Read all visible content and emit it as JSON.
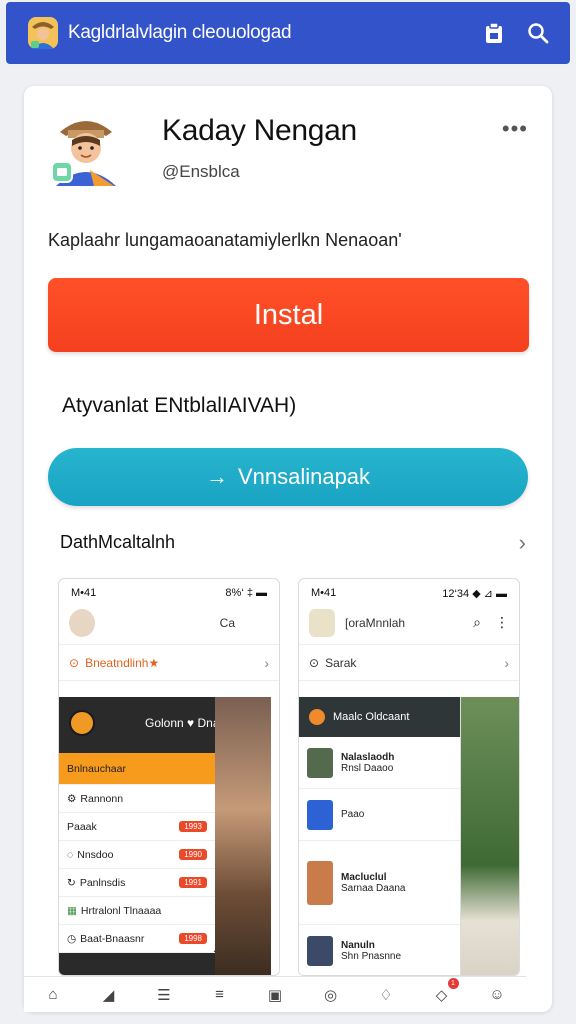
{
  "topbar": {
    "title": "Kagldrlalvlagin cleouologad",
    "icons": [
      "app-logo-icon",
      "clipboard-icon",
      "search-icon"
    ]
  },
  "profile": {
    "name": "Kaday Nengan",
    "handle": "@Ensblca",
    "more_label": "•••"
  },
  "description": "Kaplaahr lungamaoanatamiylerlkn Nenaoan'",
  "install_button": "Instal",
  "advance_text": "Atyvanlat ENtblalIAIVAH)",
  "secondary_button": "Vnnsalinapak",
  "section": {
    "title": "DathMcaltalnh",
    "chevron": "›"
  },
  "screenshots": [
    {
      "status_left": "M•41",
      "status_right": "8%‘ ‡ ▬",
      "head_text": "Ca",
      "row_text": "Bneatndlinh★",
      "panel_title": "Golonn ♥ Dnaenn",
      "menu": [
        {
          "label": "Bnlnauchaar",
          "pill": ""
        },
        {
          "label": "Rannonn",
          "pill": ""
        },
        {
          "label": "Paaak",
          "pill": "1993"
        },
        {
          "label": "Nnsdoo",
          "pill": "1990"
        },
        {
          "label": "Panlnsdis",
          "pill": "1991"
        },
        {
          "label": "Hrtralonl Tlnaaaa",
          "pill": ""
        },
        {
          "label": "Baat-Bnaasnr",
          "pill": "1998"
        }
      ]
    },
    {
      "status_left": "M•41",
      "status_right": "12‘34 ◆ ⊿ ▬",
      "head_text": "[oraMnnlah",
      "row_text": "Sarak",
      "panel_title": "Maalc Oldcaant",
      "items": [
        {
          "title": "Nalaslaodh",
          "sub": "Rnsl Daaoo"
        },
        {
          "title": "Paao",
          "sub": ""
        },
        {
          "title": "Macluclul",
          "sub": "Sarnaa Daana"
        },
        {
          "title": "Nanuln",
          "sub": "Shn Pnasnne"
        }
      ]
    }
  ],
  "bottom_nav": {
    "icons": [
      "home-icon",
      "folder-icon",
      "list-icon",
      "stack-icon",
      "calendar-icon",
      "chat-icon",
      "bell-icon",
      "notification-icon",
      "profile-icon"
    ],
    "badge": "1"
  },
  "colors": {
    "topbar": "#3253c9",
    "install": "#f4401e",
    "secondary": "#1aa3c4"
  }
}
